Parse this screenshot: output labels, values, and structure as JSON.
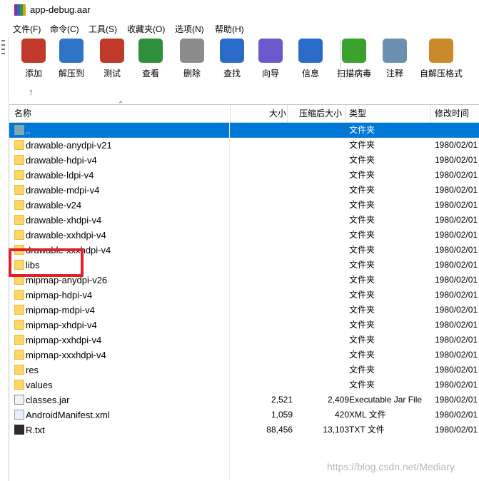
{
  "window": {
    "title": "app-debug.aar"
  },
  "menu": [
    "文件(F)",
    "命令(C)",
    "工具(S)",
    "收藏夹(O)",
    "选项(N)",
    "帮助(H)"
  ],
  "toolbar": [
    {
      "label": "添加",
      "icon": "books-add-icon",
      "color": "#c0392b"
    },
    {
      "label": "解压到",
      "icon": "folder-extract-icon",
      "color": "#2e75c7"
    },
    {
      "label": "测试",
      "icon": "clipboard-check-icon",
      "color": "#c0392b"
    },
    {
      "label": "查看",
      "icon": "book-view-icon",
      "color": "#2f8f3a"
    },
    {
      "label": "删除",
      "icon": "trash-icon",
      "color": "#8c8c8c"
    },
    {
      "label": "查找",
      "icon": "magnifier-icon",
      "color": "#2a6bc9"
    },
    {
      "label": "向导",
      "icon": "wizard-wand-icon",
      "color": "#6a5acd"
    },
    {
      "label": "信息",
      "icon": "info-icon",
      "color": "#2a6bc9"
    },
    {
      "label": "扫描病毒",
      "icon": "virus-scan-icon",
      "color": "#3aa02e"
    },
    {
      "label": "注释",
      "icon": "comment-icon",
      "color": "#6b8fb0"
    },
    {
      "label": "自解压格式",
      "icon": "sfx-box-icon",
      "color": "#c98b2a"
    }
  ],
  "columns": {
    "name": "名称",
    "size": "大小",
    "packed": "压缩后大小",
    "type": "类型",
    "modified": "修改时间"
  },
  "files": [
    {
      "name": "..",
      "size": "",
      "packed": "",
      "type": "文件夹",
      "modified": "",
      "kind": "parent"
    },
    {
      "name": "drawable-anydpi-v21",
      "size": "",
      "packed": "",
      "type": "文件夹",
      "modified": "1980/02/01",
      "kind": "folder"
    },
    {
      "name": "drawable-hdpi-v4",
      "size": "",
      "packed": "",
      "type": "文件夹",
      "modified": "1980/02/01",
      "kind": "folder"
    },
    {
      "name": "drawable-ldpi-v4",
      "size": "",
      "packed": "",
      "type": "文件夹",
      "modified": "1980/02/01",
      "kind": "folder"
    },
    {
      "name": "drawable-mdpi-v4",
      "size": "",
      "packed": "",
      "type": "文件夹",
      "modified": "1980/02/01",
      "kind": "folder"
    },
    {
      "name": "drawable-v24",
      "size": "",
      "packed": "",
      "type": "文件夹",
      "modified": "1980/02/01",
      "kind": "folder"
    },
    {
      "name": "drawable-xhdpi-v4",
      "size": "",
      "packed": "",
      "type": "文件夹",
      "modified": "1980/02/01",
      "kind": "folder"
    },
    {
      "name": "drawable-xxhdpi-v4",
      "size": "",
      "packed": "",
      "type": "文件夹",
      "modified": "1980/02/01",
      "kind": "folder"
    },
    {
      "name": "drawable-xxxhdpi-v4",
      "size": "",
      "packed": "",
      "type": "文件夹",
      "modified": "1980/02/01",
      "kind": "folder"
    },
    {
      "name": "libs",
      "size": "",
      "packed": "",
      "type": "文件夹",
      "modified": "1980/02/01",
      "kind": "folder"
    },
    {
      "name": "mipmap-anydpi-v26",
      "size": "",
      "packed": "",
      "type": "文件夹",
      "modified": "1980/02/01",
      "kind": "folder"
    },
    {
      "name": "mipmap-hdpi-v4",
      "size": "",
      "packed": "",
      "type": "文件夹",
      "modified": "1980/02/01",
      "kind": "folder"
    },
    {
      "name": "mipmap-mdpi-v4",
      "size": "",
      "packed": "",
      "type": "文件夹",
      "modified": "1980/02/01",
      "kind": "folder"
    },
    {
      "name": "mipmap-xhdpi-v4",
      "size": "",
      "packed": "",
      "type": "文件夹",
      "modified": "1980/02/01",
      "kind": "folder"
    },
    {
      "name": "mipmap-xxhdpi-v4",
      "size": "",
      "packed": "",
      "type": "文件夹",
      "modified": "1980/02/01",
      "kind": "folder"
    },
    {
      "name": "mipmap-xxxhdpi-v4",
      "size": "",
      "packed": "",
      "type": "文件夹",
      "modified": "1980/02/01",
      "kind": "folder"
    },
    {
      "name": "res",
      "size": "",
      "packed": "",
      "type": "文件夹",
      "modified": "1980/02/01",
      "kind": "folder"
    },
    {
      "name": "values",
      "size": "",
      "packed": "",
      "type": "文件夹",
      "modified": "1980/02/01",
      "kind": "folder"
    },
    {
      "name": "classes.jar",
      "size": "2,521",
      "packed": "2,409",
      "type": "Executable Jar File",
      "modified": "1980/02/01",
      "kind": "jar"
    },
    {
      "name": "AndroidManifest.xml",
      "size": "1,059",
      "packed": "420",
      "type": "XML 文件",
      "modified": "1980/02/01",
      "kind": "xml"
    },
    {
      "name": "R.txt",
      "size": "88,456",
      "packed": "13,103",
      "type": "TXT 文件",
      "modified": "1980/02/01",
      "kind": "txt"
    }
  ],
  "selected_index": 0,
  "highlight_color": "#e0202a",
  "watermark": "https://blog.csdn.net/Mediary"
}
